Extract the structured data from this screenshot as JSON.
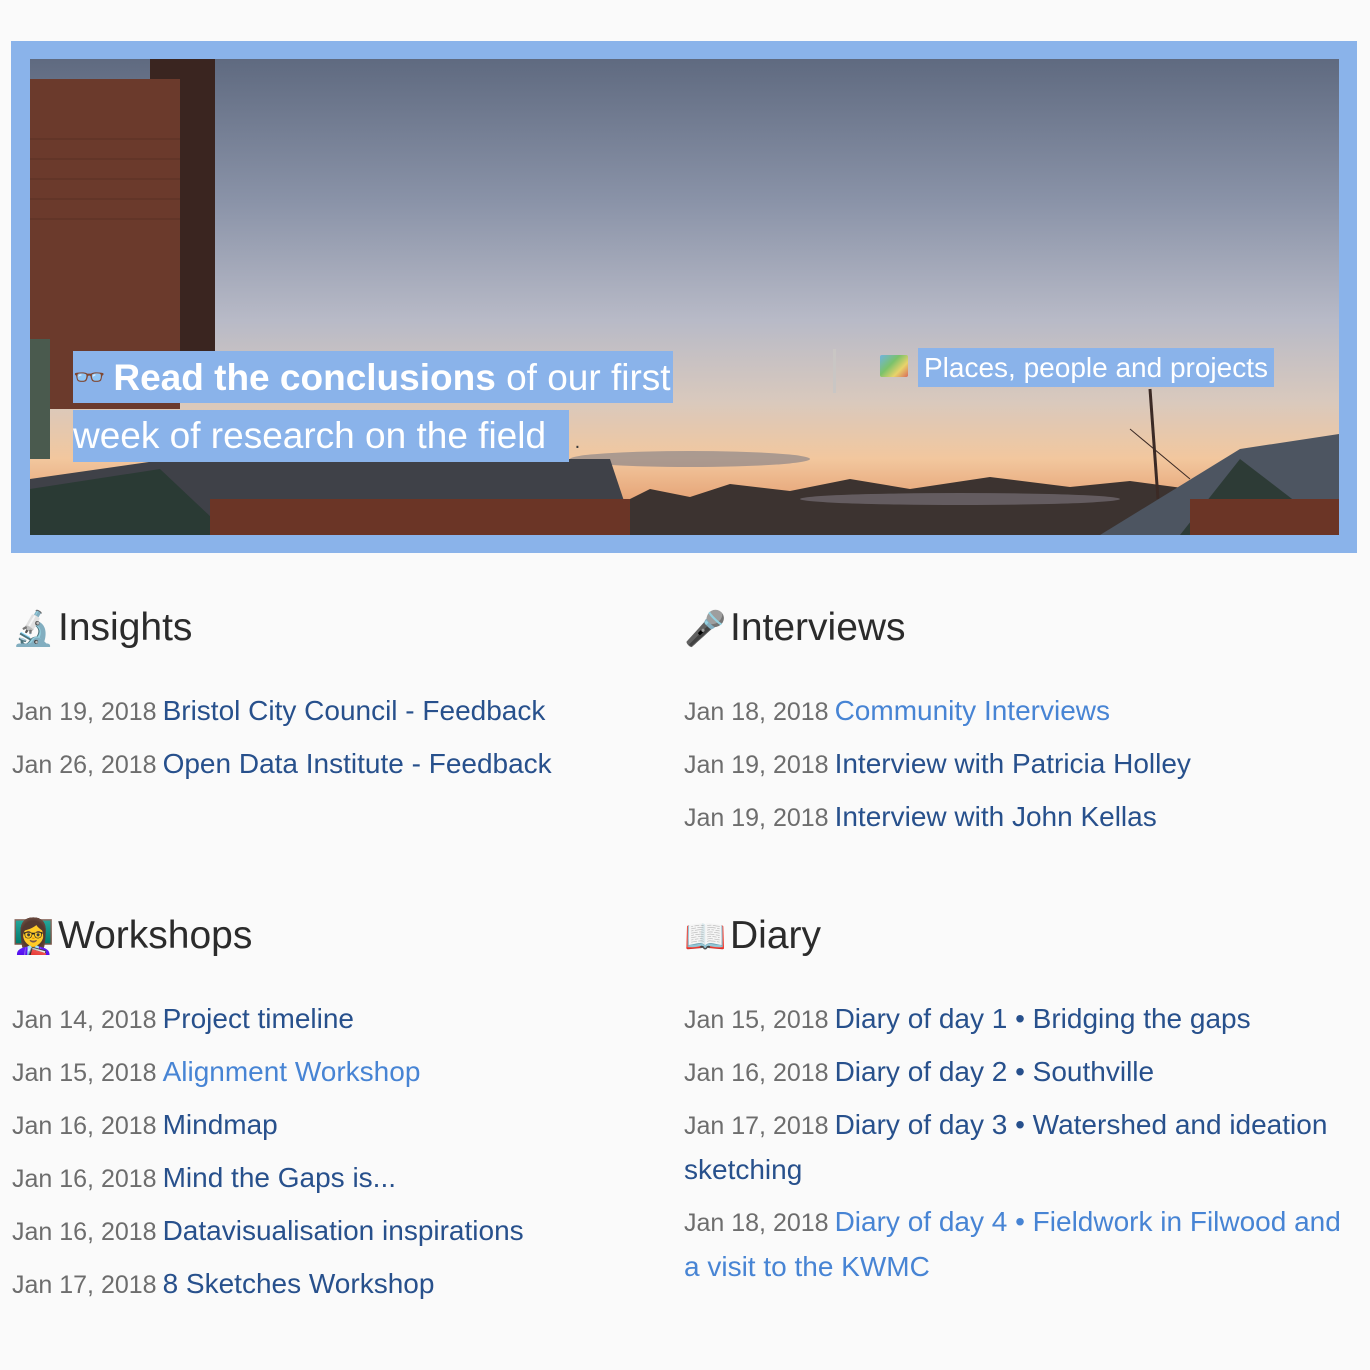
{
  "hero": {
    "left": {
      "icon": "glasses-icon",
      "bold_text": "Read the conclusions",
      "text_rest": "of our first",
      "text_line2": "week of research on the field",
      "trailing": "."
    },
    "right": {
      "icon": "map-icon",
      "text": "Places, people and projects"
    }
  },
  "insights": {
    "title": "Insights",
    "icon": "microscope-icon",
    "entries": [
      {
        "date": "Jan 19, 2018",
        "title": "Bristol City Council - Feedback"
      },
      {
        "date": "Jan 26, 2018",
        "title": "Open Data Institute - Feedback"
      }
    ]
  },
  "interviews": {
    "title": "Interviews",
    "icon": "microphone-icon",
    "entries": [
      {
        "date": "Jan 18, 2018",
        "title": "Community Interviews"
      },
      {
        "date": "Jan 19, 2018",
        "title": "Interview with Patricia Holley"
      },
      {
        "date": "Jan 19, 2018",
        "title": "Interview with John Kellas"
      }
    ]
  },
  "workshops": {
    "title": "Workshops",
    "icon": "teacher-icon",
    "entries": [
      {
        "date": "Jan 14, 2018",
        "title": "Project timeline"
      },
      {
        "date": "Jan 15, 2018",
        "title": "Alignment Workshop"
      },
      {
        "date": "Jan 16, 2018",
        "title": "Mindmap"
      },
      {
        "date": "Jan 16, 2018",
        "title": "Mind the Gaps is..."
      },
      {
        "date": "Jan 16, 2018",
        "title": "Datavisualisation inspirations"
      },
      {
        "date": "Jan 17, 2018",
        "title": "8 Sketches Workshop"
      }
    ]
  },
  "diary": {
    "title": "Diary",
    "icon": "open-book-icon",
    "entries": [
      {
        "date": "Jan 15, 2018",
        "title": "Diary of day 1 • Bridging the gaps"
      },
      {
        "date": "Jan 16, 2018",
        "title": "Diary of day 2 • Southville"
      },
      {
        "date": "Jan 17, 2018",
        "title": "Diary of day 3 • Watershed and ideation sketching"
      },
      {
        "date": "Jan 18, 2018",
        "title": "Diary of day 4 • Fieldwork in Filwood and a visit to the KWMC"
      }
    ]
  },
  "colors": {
    "accent": "#8ab3ea",
    "link": "#27508c",
    "link_visited_light": "#4784d4",
    "date": "#6d6d6d"
  }
}
